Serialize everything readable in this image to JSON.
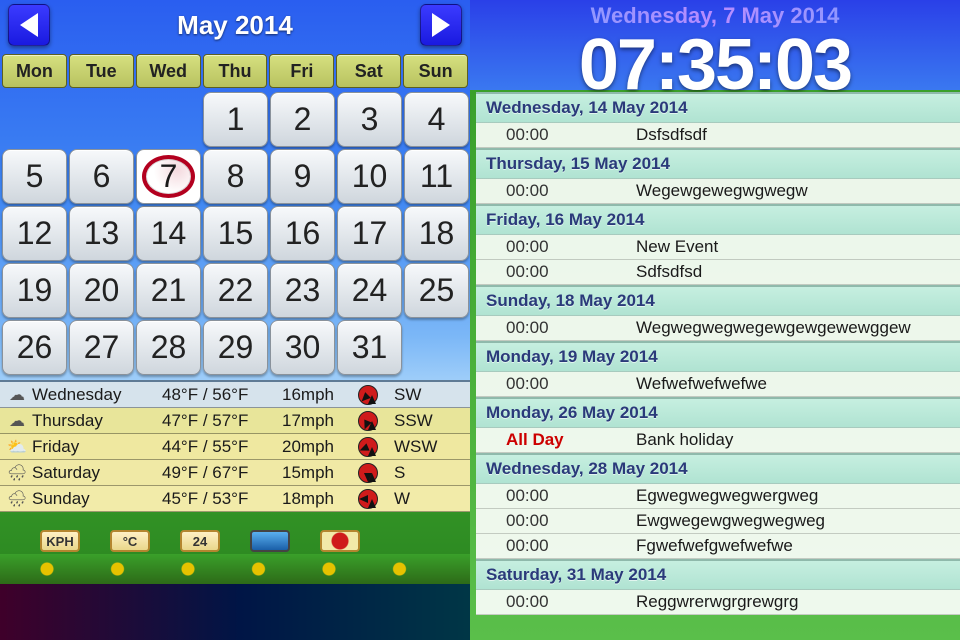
{
  "header": {
    "month_title": "May 2014"
  },
  "weekdays": [
    "Mon",
    "Tue",
    "Wed",
    "Thu",
    "Fri",
    "Sat",
    "Sun"
  ],
  "calendar": {
    "leading_blanks": 3,
    "days_in_month": 31,
    "today": 7
  },
  "weather": [
    {
      "icon": "☁",
      "day": "Wednesday",
      "temp": "48°F / 56°F",
      "wind": "16mph",
      "dir_deg": 225,
      "dir": "SW"
    },
    {
      "icon": "☁",
      "day": "Thursday",
      "temp": "47°F / 57°F",
      "wind": "17mph",
      "dir_deg": 202,
      "dir": "SSW"
    },
    {
      "icon": "⛅",
      "day": "Friday",
      "temp": "44°F / 55°F",
      "wind": "20mph",
      "dir_deg": 247,
      "dir": "WSW"
    },
    {
      "icon": "🌧",
      "day": "Saturday",
      "temp": "49°F / 67°F",
      "wind": "15mph",
      "dir_deg": 180,
      "dir": "S"
    },
    {
      "icon": "🌧",
      "day": "Sunday",
      "temp": "45°F / 53°F",
      "wind": "18mph",
      "dir_deg": 270,
      "dir": "W"
    }
  ],
  "options": {
    "speed_unit": "KPH",
    "temp_unit": "°C",
    "hour_fmt": "24"
  },
  "clock": {
    "date_line": "Wednesday, 7 May 2014",
    "time": "07:35:03"
  },
  "agenda": [
    {
      "header": "Wednesday, 14 May 2014",
      "rows": [
        {
          "time": "00:00",
          "title": "Dsfsdfsdf"
        }
      ]
    },
    {
      "header": "Thursday, 15 May 2014",
      "rows": [
        {
          "time": "00:00",
          "title": "Wegewgewegwgwegw"
        }
      ]
    },
    {
      "header": "Friday, 16 May 2014",
      "rows": [
        {
          "time": "00:00",
          "title": "New Event"
        },
        {
          "time": "00:00",
          "title": "Sdfsdfsd"
        }
      ]
    },
    {
      "header": "Sunday, 18 May 2014",
      "rows": [
        {
          "time": "00:00",
          "title": "Wegwegwegwegewgewgewewggew"
        }
      ]
    },
    {
      "header": "Monday, 19 May 2014",
      "rows": [
        {
          "time": "00:00",
          "title": "Wefwefwefwefwe"
        }
      ]
    },
    {
      "header": "Monday, 26 May 2014",
      "rows": [
        {
          "time": "All Day",
          "allday": true,
          "title": "Bank holiday"
        }
      ]
    },
    {
      "header": "Wednesday, 28 May 2014",
      "rows": [
        {
          "time": "00:00",
          "title": "Egwegwegwegwergweg"
        },
        {
          "time": "00:00",
          "title": "Ewgwegewgwegwegweg"
        },
        {
          "time": "00:00",
          "title": "Fgwefwefgwefwefwe"
        }
      ]
    },
    {
      "header": "Saturday, 31 May 2014",
      "rows": [
        {
          "time": "00:00",
          "title": "Reggwrerwgrgrewgrg"
        }
      ]
    }
  ]
}
